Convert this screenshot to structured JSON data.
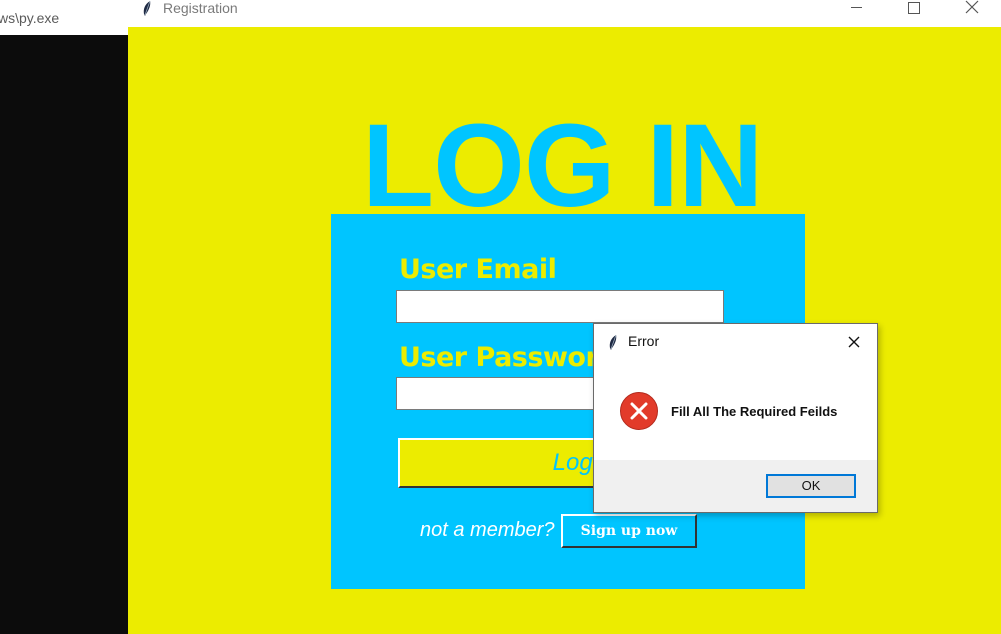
{
  "console": {
    "title": "ws\\py.exe"
  },
  "window": {
    "title": "Registration",
    "icon": "feather-icon",
    "controls": [
      "minimize-icon",
      "maximize-icon",
      "close-icon"
    ]
  },
  "login": {
    "heading": "LOG IN",
    "email_label": "User Email",
    "email_value": "",
    "password_label": "User Password",
    "password_value": "",
    "login_button": "Log In",
    "not_member_text": "not a member?",
    "signup_button": "Sign up now"
  },
  "dialog": {
    "title": "Error",
    "icon": "error-icon",
    "message": "Fill All The Required Feilds",
    "ok_button": "OK"
  },
  "colors": {
    "background": "#ecec00",
    "accent": "#00c5ff",
    "error": "#e23b2a",
    "focus": "#0078d7"
  }
}
